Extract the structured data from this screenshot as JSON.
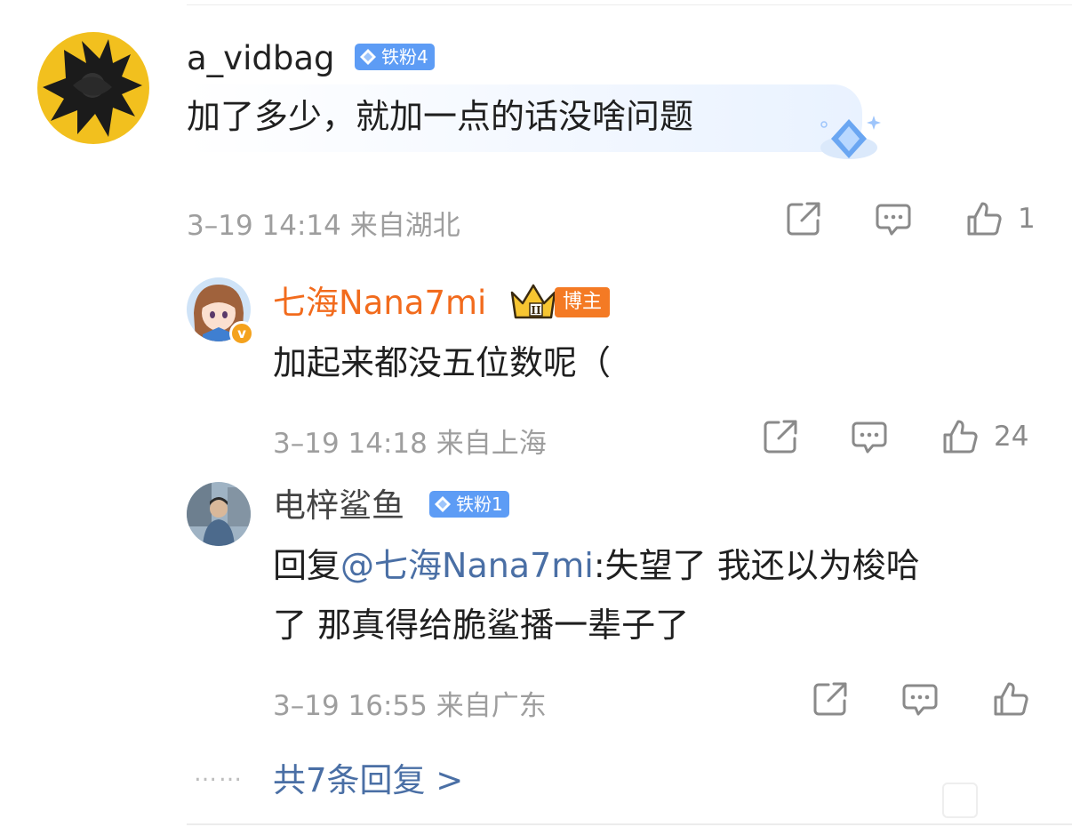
{
  "main_comment": {
    "username": "a_vidbag",
    "fan_badge": "铁粉4",
    "text": "加了多少，就加一点的话没啥问题",
    "date": "3–19 14:14",
    "location": "来自湖北",
    "like_count": "1"
  },
  "replies": [
    {
      "username": "七海Nana7mi",
      "badge": "博主",
      "crown_level": "II",
      "verified_mark": "v",
      "text": "加起来都没五位数呢（",
      "date": "3–19 14:18",
      "location": "来自上海",
      "like_count": "24"
    },
    {
      "username": "电梓鲨鱼",
      "fan_badge": "铁粉1",
      "text_prefix": "回复",
      "mention": "@七海Nana7mi",
      "text_line1": ":失望了  我还以为梭哈",
      "text_line2": "了  那真得给脆鲨播一辈子了",
      "date": "3–19 16:55",
      "location": "来自广东",
      "like_count": ""
    }
  ],
  "more_replies": {
    "dots": "……",
    "label": "共7条回复 >"
  },
  "colors": {
    "blogger_orange": "#f26b1d",
    "mention_blue": "#4a6fa5",
    "fan_badge_blue": "#5d9cf5",
    "meta_gray": "#9e9e9e"
  },
  "icons": [
    "share-icon",
    "comment-icon",
    "like-icon",
    "diamond-icon",
    "crown-icon",
    "verified-icon"
  ]
}
